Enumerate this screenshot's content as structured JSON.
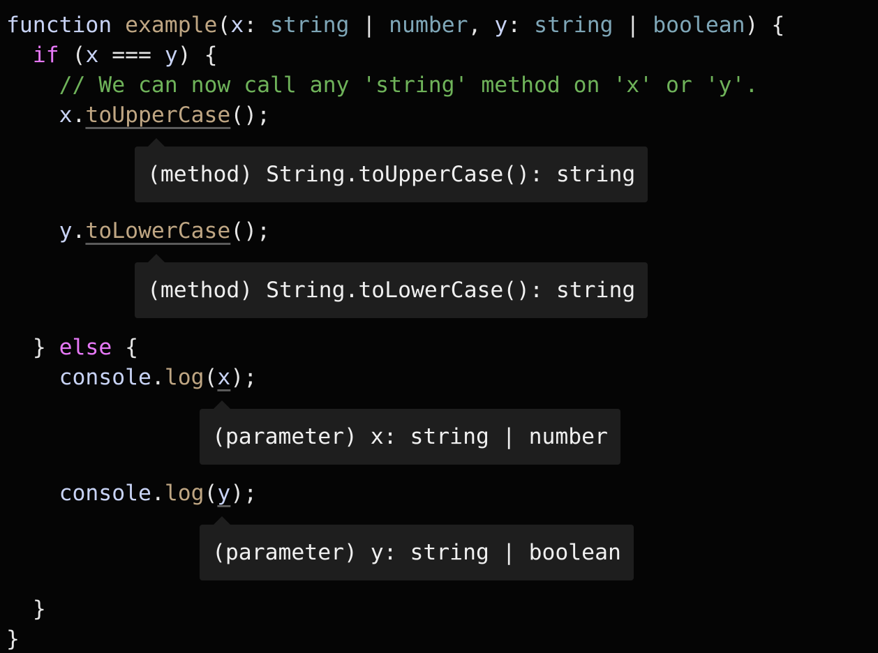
{
  "code": {
    "line1": {
      "keyword": "function",
      "name": "example",
      "open": "(",
      "param_x": "x",
      "colon1": ":",
      "type_string1": "string",
      "pipe1": "|",
      "type_number": "number",
      "comma": ",",
      "param_y": "y",
      "colon2": ":",
      "type_string2": "string",
      "pipe2": "|",
      "type_boolean": "boolean",
      "close": ")",
      "brace": "{"
    },
    "line2": {
      "keyword": "if",
      "open": "(",
      "var_x": "x",
      "op": "===",
      "var_y": "y",
      "close": ")",
      "brace": "{"
    },
    "comment": "// We can now call any 'string' method on 'x' or 'y'.",
    "line4": {
      "obj": "x",
      "dot": ".",
      "method": "toUpperCase",
      "tail": "();"
    },
    "line5": {
      "obj": "y",
      "dot": ".",
      "method": "toLowerCase",
      "tail": "();"
    },
    "else_line": {
      "close_brace": "}",
      "keyword": "else",
      "brace": "{"
    },
    "line_log_x": {
      "obj": "console",
      "dot": ".",
      "method": "log",
      "open": "(",
      "arg": "x",
      "tail": ");"
    },
    "line_log_y": {
      "obj": "console",
      "dot": ".",
      "method": "log",
      "open": "(",
      "arg": "y",
      "tail": ");"
    },
    "inner_close": "}",
    "outer_close": "}"
  },
  "tooltips": {
    "to_upper": "(method) String.toUpperCase(): string",
    "to_lower": "(method) String.toLowerCase(): string",
    "param_x": "(parameter) x: string | number",
    "param_y": "(parameter) y: string | boolean"
  },
  "colors": {
    "background": "#050505",
    "keyword": "#e879f9",
    "function_name": "#bfa683",
    "type": "#7fa7b8",
    "variable": "#c8d3f5",
    "comment": "#6fb35a",
    "tooltip_bg": "#1e1e1e"
  }
}
